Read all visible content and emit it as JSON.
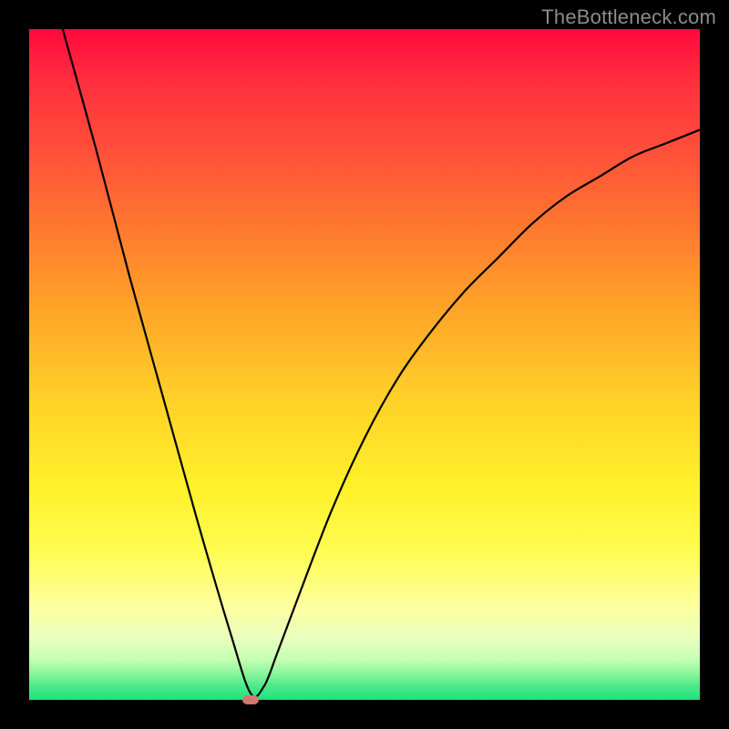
{
  "watermark": "TheBottleneck.com",
  "chart_data": {
    "type": "line",
    "title": "",
    "xlabel": "",
    "ylabel": "",
    "xlim": [
      0,
      100
    ],
    "ylim": [
      0,
      100
    ],
    "grid": false,
    "series": [
      {
        "name": "bottleneck-curve",
        "x": [
          5,
          10,
          15,
          20,
          25,
          30,
          33,
          35,
          37,
          40,
          45,
          50,
          55,
          60,
          65,
          70,
          75,
          80,
          85,
          90,
          95,
          100
        ],
        "values": [
          100,
          82,
          63,
          45,
          27,
          10,
          1,
          2,
          7,
          15,
          28,
          39,
          48,
          55,
          61,
          66,
          71,
          75,
          78,
          81,
          83,
          85
        ]
      }
    ],
    "marker": {
      "x": 33,
      "y": 0
    },
    "colors": {
      "curve": "#000000",
      "gradient_top": "#ff0a3d",
      "gradient_bottom": "#1fe27b",
      "marker": "#d6766e"
    }
  }
}
